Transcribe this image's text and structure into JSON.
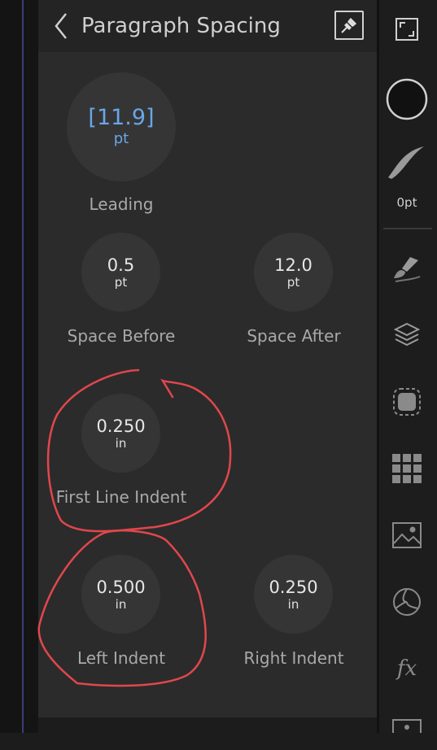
{
  "panel": {
    "title": "Paragraph Spacing",
    "back_icon": "chevron-left-icon",
    "pin_icon": "pin-icon"
  },
  "leading": {
    "value": "[11.9]",
    "unit": "pt",
    "label": "Leading",
    "accent": "#6aa6e8"
  },
  "space_before": {
    "value": "0.5",
    "unit": "pt",
    "label": "Space Before"
  },
  "space_after": {
    "value": "12.0",
    "unit": "pt",
    "label": "Space After"
  },
  "first_line_indent": {
    "value": "0.250",
    "unit": "in",
    "label": "First Line Indent"
  },
  "left_indent": {
    "value": "0.500",
    "unit": "in",
    "label": "Left Indent"
  },
  "right_indent": {
    "value": "0.250",
    "unit": "in",
    "label": "Right Indent"
  },
  "toolbar": {
    "stroke_width": "0pt",
    "icons": [
      "fullscreen-icon",
      "color-swatch-icon",
      "stroke-icon",
      "brush-icon",
      "layers-icon",
      "selection-icon",
      "grid-icon",
      "image-icon",
      "color-wheel-icon",
      "fx-icon"
    ],
    "fx_label": "fx"
  },
  "annotation_color": "#e0474c"
}
